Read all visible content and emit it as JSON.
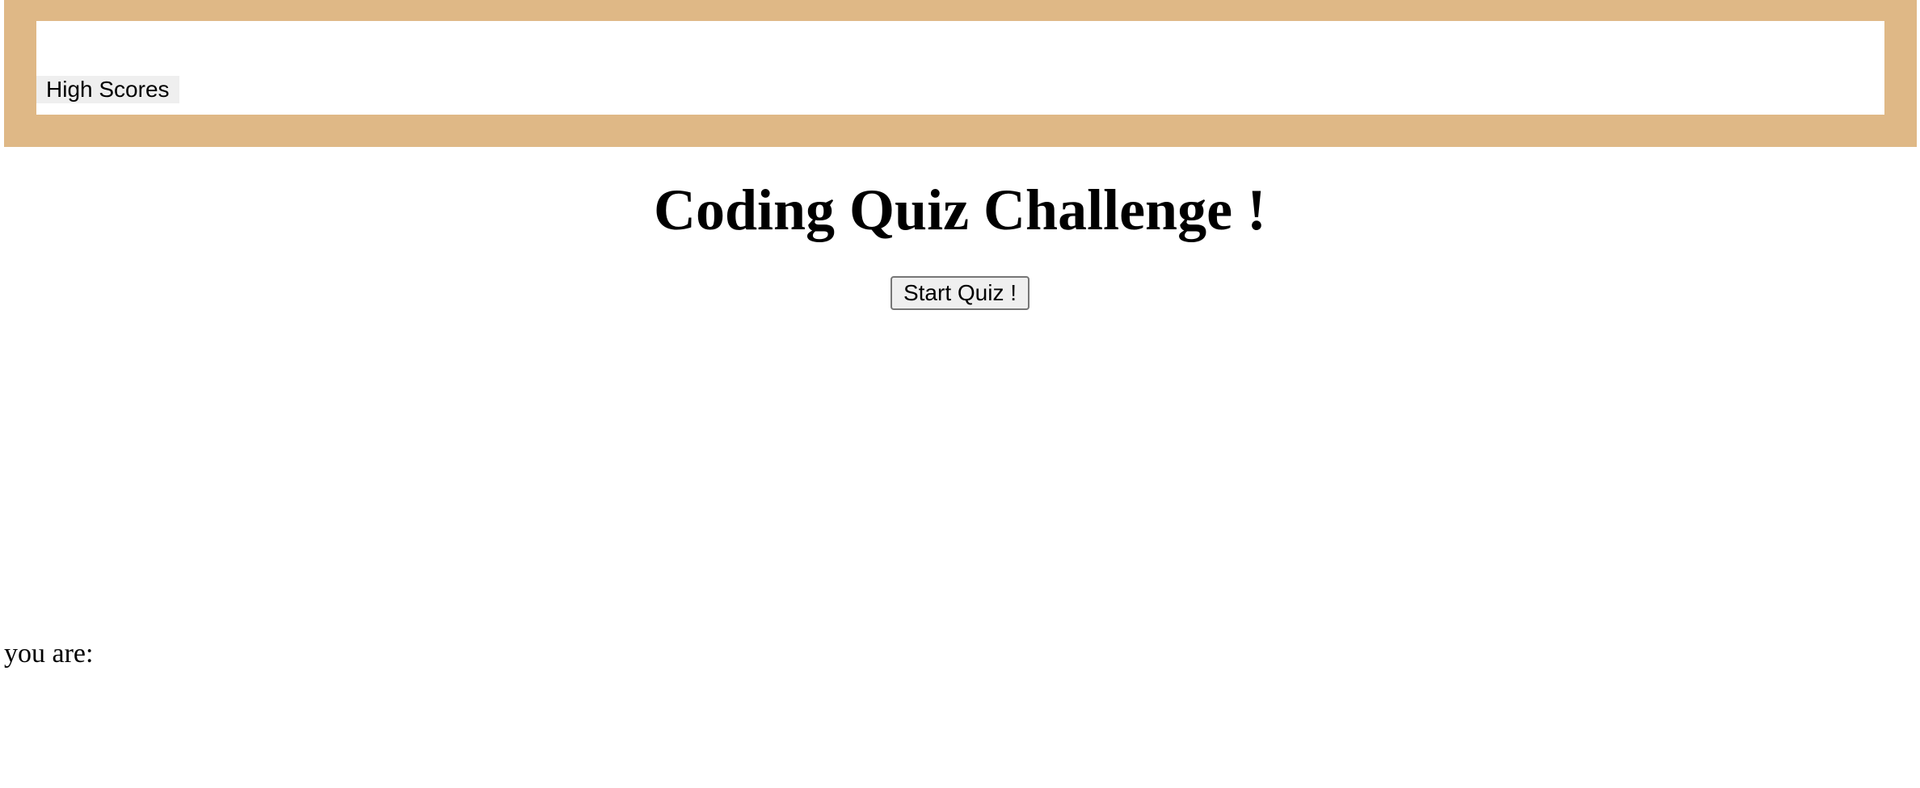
{
  "header": {
    "high_scores_label": "High Scores"
  },
  "main": {
    "title": "Coding Quiz Challenge !",
    "start_button_label": "Start Quiz !"
  },
  "result": {
    "label": "you are:"
  },
  "colors": {
    "header_band": "#dfb886",
    "header_inner": "#ffffff",
    "button_background": "#efefef"
  }
}
